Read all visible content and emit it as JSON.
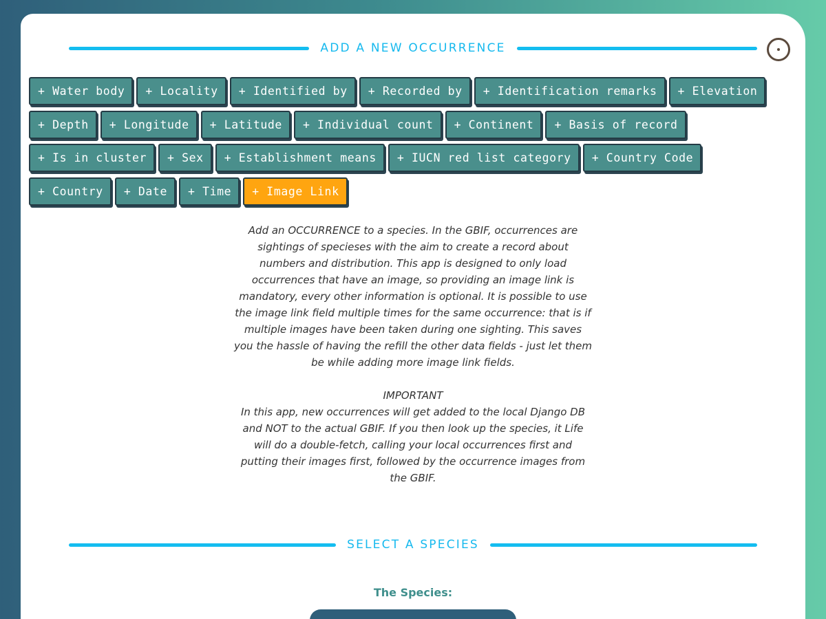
{
  "add_section": {
    "title": "ADD A NEW OCCURRENCE"
  },
  "field_buttons": {
    "row1": [
      "+ Water body",
      "+ Locality",
      "+ Identified by",
      "+ Recorded by",
      "+ Identification remarks",
      "+ Elevation"
    ],
    "row2": [
      "+ Depth",
      "+ Longitude",
      "+ Latitude",
      "+ Individual count",
      "+ Continent",
      "+ Basis of record"
    ],
    "row3": [
      "+ Is in cluster",
      "+ Sex",
      "+ Establishment means",
      "+ IUCN red list category",
      "+ Country Code"
    ],
    "row4": [
      "+ Country",
      "+ Date",
      "+ Time",
      "+ Image Link"
    ],
    "active": "+ Image Link"
  },
  "description": {
    "para1": "Add an OCCURRENCE to a species. In the GBIF, occurrences are sightings of specieses with the aim to create a record about numbers and distribution. This app is designed to only load occurrences that have an image, so providing an image link is mandatory, every other information is optional. It is possible to use the image link field multiple times for the same occurrence: that is if multiple images have been taken during one sighting. This saves you the hassle of having the refill the other data fields - just let them be while adding more image link fields.",
    "heading2": "IMPORTANT",
    "para2": "In this app, new occurrences will get added to the local Django DB and NOT to the actual GBIF. If you then look up the species, it Life will do a double-fetch, calling your local occurrences first and putting their images first, followed by the occurrence images from the GBIF."
  },
  "species_section": {
    "title": "SELECT A SPECIES",
    "label": "The Species:"
  },
  "colors": {
    "accent_line": "#14bdf0",
    "button_bg": "#4a8f8c",
    "button_active_bg": "#ffa510",
    "species_label": "#3f8f8c"
  },
  "icons": {
    "close": "close-circle-icon"
  }
}
